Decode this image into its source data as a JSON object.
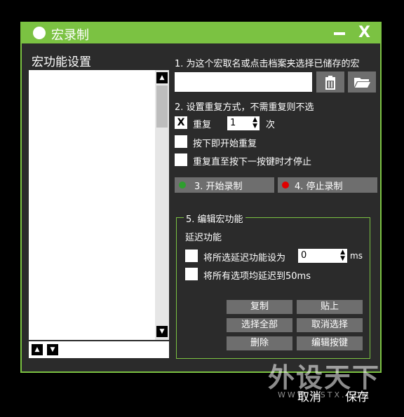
{
  "window": {
    "title": "宏录制",
    "close_label": "X",
    "accent": "#7bc242"
  },
  "left": {
    "title": "宏功能设置",
    "items": [],
    "scroll_up_icon": "up-triangle",
    "scroll_down_icon": "down-triangle"
  },
  "right": {
    "step1_label": "1. 为这个宏取名或点击档案夹选择已储存的宏",
    "name_value": "",
    "delete_icon": "trash-icon",
    "folder_icon": "folder-icon",
    "step2_label": "2. 设置重复方式，不需重复则不选",
    "repeat_checkbox_mark": "X",
    "repeat_label": "重复",
    "repeat_count": "1",
    "repeat_unit": "次",
    "hold_repeat_label": "按下即开始重复",
    "until_press_label": "重复直至按下一按键时才停止",
    "start_record_label": "3.  开始录制",
    "stop_record_label": "4. 停止录制",
    "start_dot_color": "#2e9e2e",
    "stop_dot_color": "#e00000"
  },
  "edit": {
    "legend": "5. 编辑宏功能",
    "delay_title": "延迟功能",
    "set_delay_label": "将所选延迟功能设为",
    "delay_value": "0",
    "delay_unit": "ms",
    "all_delay_label": "将所有选项均延迟到50ms",
    "buttons": {
      "copy": "复制",
      "paste": "贴上",
      "select_all": "选择全部",
      "deselect": "取消选择",
      "delete": "删除",
      "edit_key": "编辑按键"
    }
  },
  "footer": {
    "cancel": "取消",
    "save": "保存"
  },
  "watermark": {
    "text": "外设天下",
    "sub": "WWW.WSTX.COM"
  }
}
